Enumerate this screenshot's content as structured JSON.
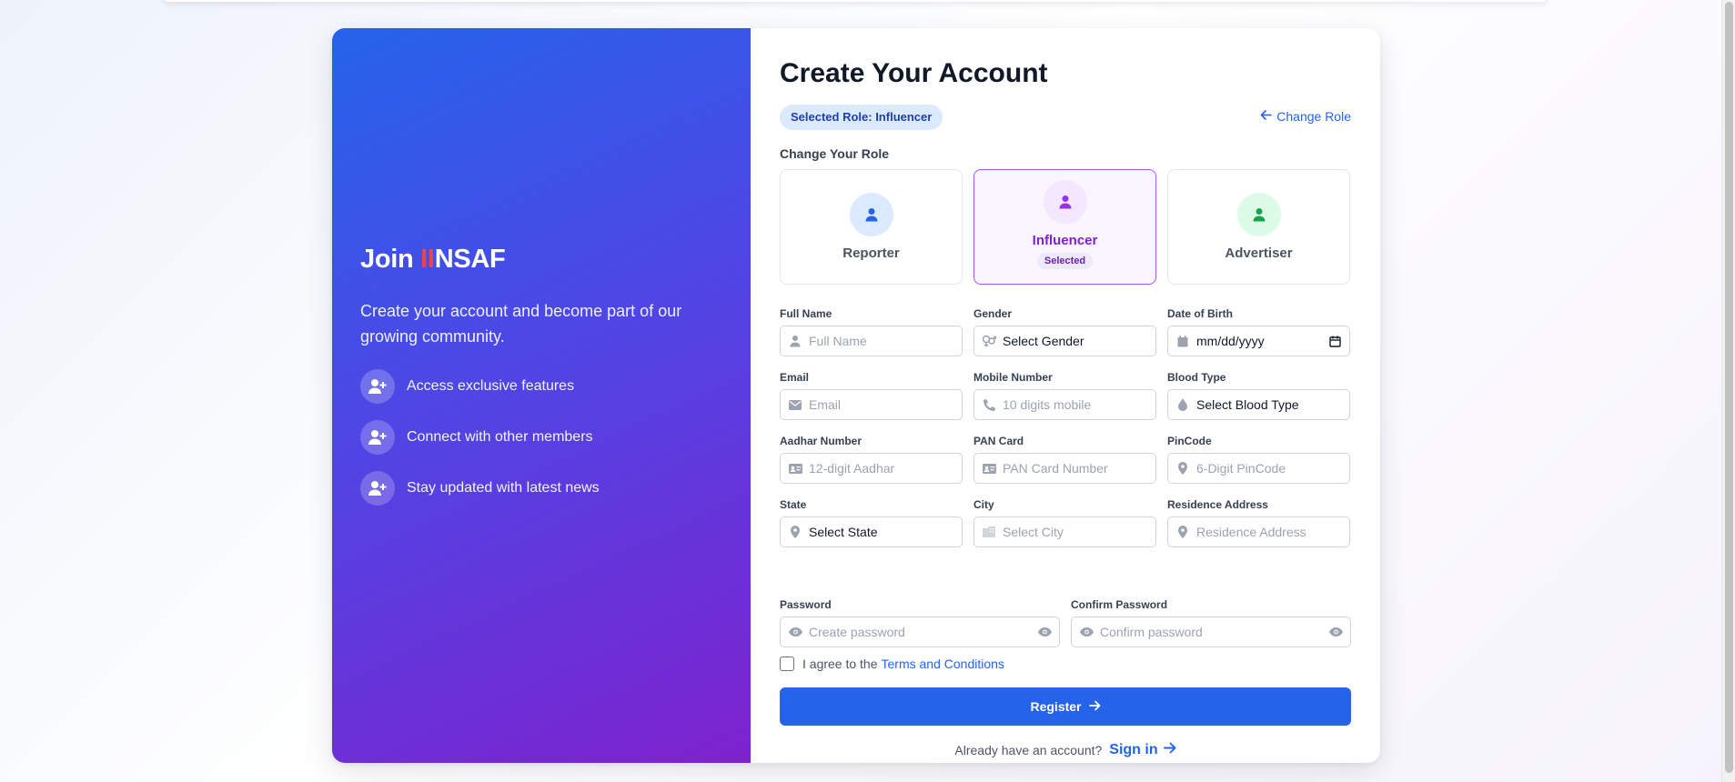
{
  "left": {
    "brand_prefix": "Join ",
    "brand_accent": "II",
    "brand_suffix": "NSAF",
    "tagline": "Create your account and become part of our growing community.",
    "features": [
      {
        "text": "Access exclusive features",
        "icon": "user-plus-icon"
      },
      {
        "text": "Connect with other members",
        "icon": "user-plus-icon"
      },
      {
        "text": "Stay updated with latest news",
        "icon": "user-plus-icon"
      }
    ]
  },
  "form": {
    "title": "Create Your Account",
    "selected_role_badge": "Selected Role: Influencer",
    "change_role_link": "Change Role",
    "role_heading": "Change Your Role",
    "roles": [
      {
        "label": "Reporter",
        "selected": false,
        "color": "#2563eb"
      },
      {
        "label": "Influencer",
        "selected": true,
        "selected_tag": "Selected",
        "color": "#9333ea"
      },
      {
        "label": "Advertiser",
        "selected": false,
        "color": "#16a34a"
      }
    ],
    "fields": {
      "full_name": {
        "label": "Full Name",
        "placeholder": "Full Name",
        "icon": "user-icon"
      },
      "gender": {
        "label": "Gender",
        "value": "Select Gender",
        "icon": "gender-icon"
      },
      "dob": {
        "label": "Date of Birth",
        "value": "mm/dd/yyyy",
        "icon": "calendar-icon"
      },
      "email": {
        "label": "Email",
        "placeholder": "Email",
        "icon": "envelope-icon"
      },
      "mobile": {
        "label": "Mobile Number",
        "placeholder": "10 digits mobile",
        "icon": "phone-icon"
      },
      "blood_type": {
        "label": "Blood Type",
        "value": "Select Blood Type",
        "icon": "droplet-icon"
      },
      "aadhar": {
        "label": "Aadhar Number",
        "placeholder": "12-digit Aadhar",
        "icon": "id-card-icon"
      },
      "pan": {
        "label": "PAN Card",
        "placeholder": "PAN Card Number",
        "icon": "id-card-icon"
      },
      "pincode": {
        "label": "PinCode",
        "placeholder": "6-Digit PinCode",
        "icon": "map-pin-icon"
      },
      "state": {
        "label": "State",
        "value": "Select State",
        "icon": "map-pin-icon"
      },
      "city": {
        "label": "City",
        "placeholder": "Select City",
        "icon": "building-icon"
      },
      "address": {
        "label": "Residence Address",
        "placeholder": "Residence Address",
        "icon": "map-pin-icon"
      },
      "password": {
        "label": "Password",
        "placeholder": "Create password",
        "icon": "eye-icon"
      },
      "confirm_password": {
        "label": "Confirm Password",
        "placeholder": "Confirm password",
        "icon": "eye-icon"
      }
    },
    "terms_text": "I agree to the",
    "terms_link": "Terms and Conditions",
    "register_label": "Register",
    "signin_prompt": "Already have an account?",
    "signin_link": "Sign in"
  },
  "colors": {
    "primary": "#2563eb",
    "accent_red": "#ef4444",
    "purple": "#9333ea",
    "green": "#16a34a"
  }
}
